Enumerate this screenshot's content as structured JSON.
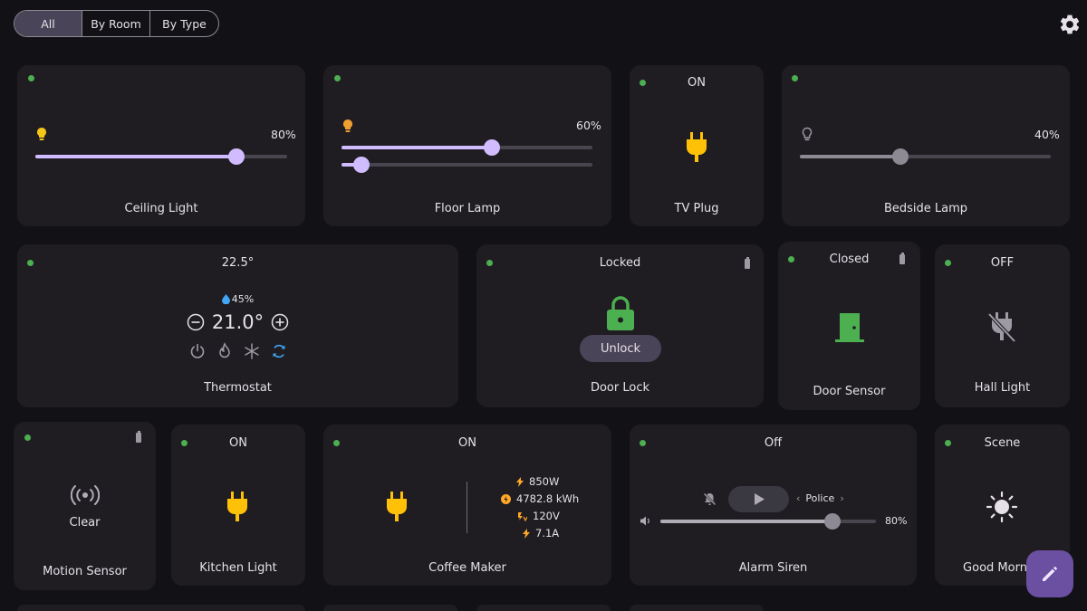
{
  "filters": {
    "all": "All",
    "by_room": "By Room",
    "by_type": "By Type"
  },
  "colors": {
    "accent": "#d0bcff",
    "online": "#4caf50",
    "bulb_yellow": "#f5c518",
    "bulb_orange": "#f0a030",
    "plug_yellow": "#ffc107",
    "lock_green": "#4caf50",
    "card_bg": "#1f1d22"
  },
  "cards": {
    "ceiling_light": {
      "name": "Ceiling Light",
      "brightness": "80%",
      "level": 0.8
    },
    "floor_lamp": {
      "name": "Floor Lamp",
      "brightness": "60%",
      "level": 0.6,
      "level2": 0.08
    },
    "tv_plug": {
      "name": "TV Plug",
      "state": "ON"
    },
    "bedside_lamp": {
      "name": "Bedside Lamp",
      "brightness": "40%",
      "level": 0.4
    },
    "thermostat": {
      "name": "Thermostat",
      "current": "22.5°",
      "humidity": "45%",
      "target": "21.0°"
    },
    "door_lock": {
      "name": "Door Lock",
      "state": "Locked",
      "action": "Unlock"
    },
    "door_sensor": {
      "name": "Door Sensor",
      "state": "Closed"
    },
    "hall_light": {
      "name": "Hall Light",
      "state": "OFF"
    },
    "motion_sensor": {
      "name": "Motion Sensor",
      "state": "Clear"
    },
    "kitchen_light": {
      "name": "Kitchen Light",
      "state": "ON"
    },
    "coffee_maker": {
      "name": "Coffee Maker",
      "state": "ON",
      "power": "850W",
      "energy": "4782.8 kWh",
      "voltage": "120V",
      "current": "7.1A"
    },
    "alarm_siren": {
      "name": "Alarm Siren",
      "state": "Off",
      "tone": "Police",
      "volume": "80%",
      "volume_level": 0.8
    },
    "good_morning": {
      "name": "Good Morn",
      "state": "Scene"
    }
  }
}
